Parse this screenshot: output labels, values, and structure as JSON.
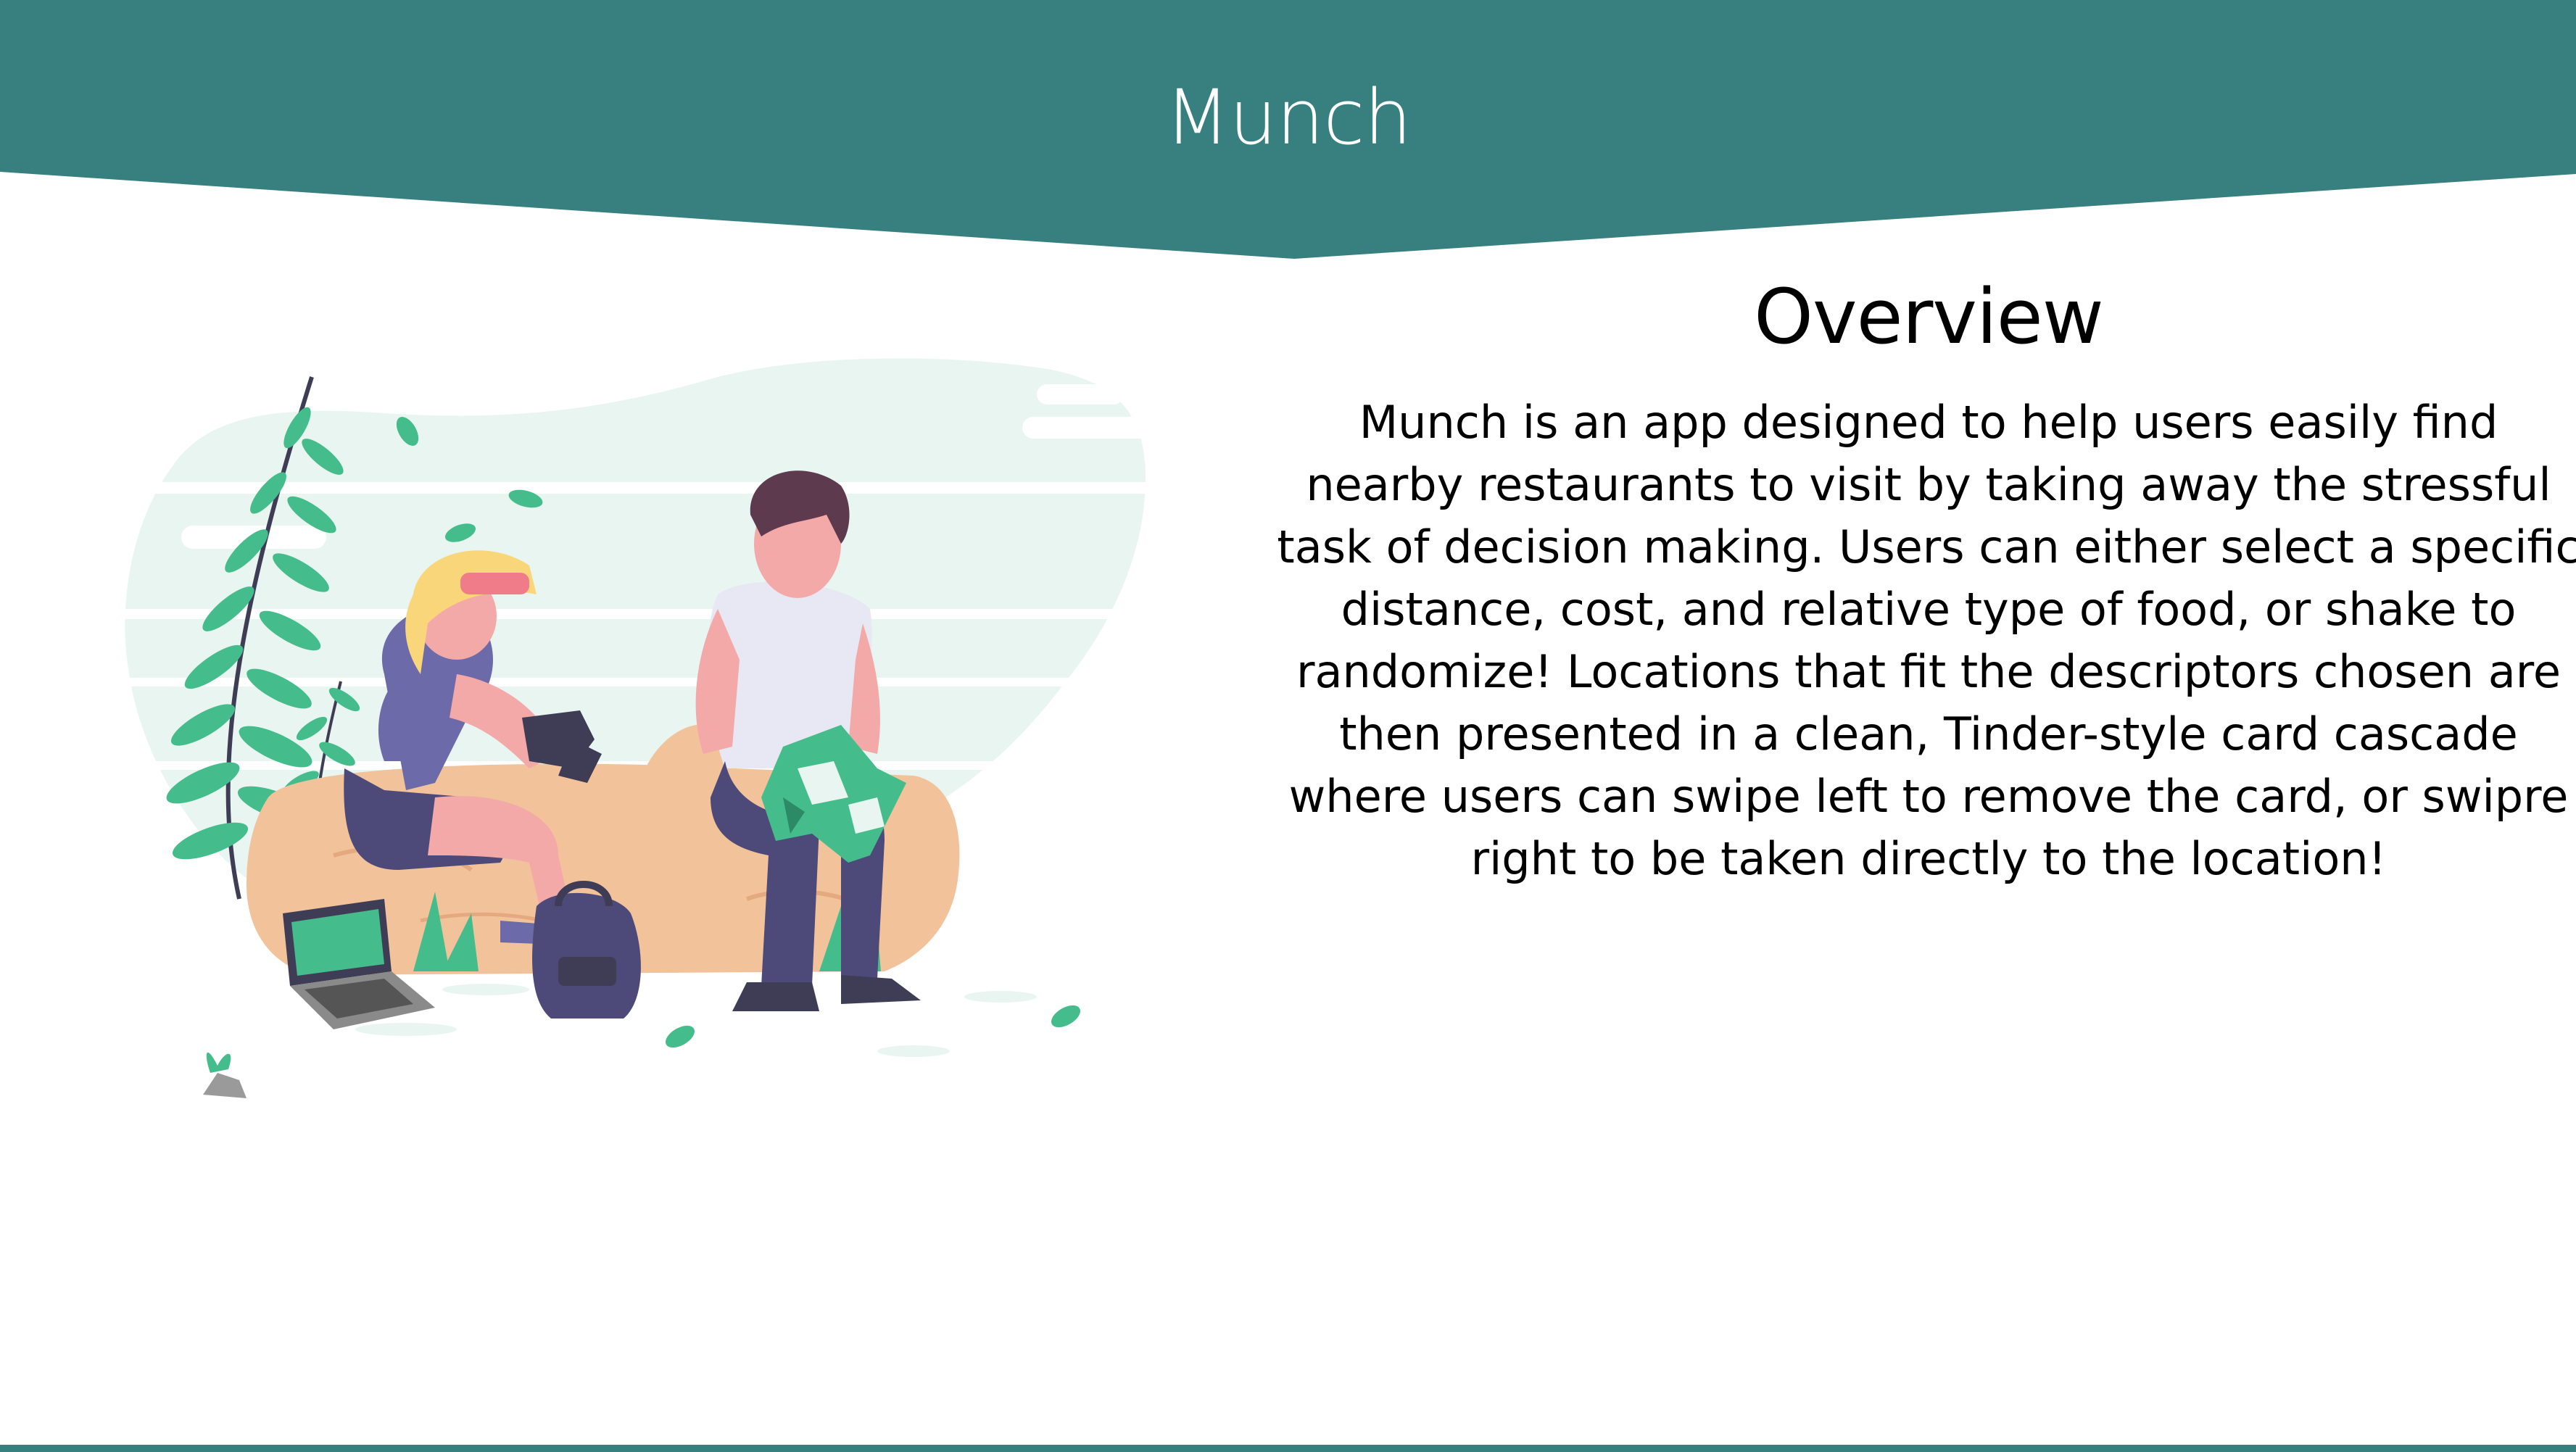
{
  "colors": {
    "brand": "#387f80",
    "accent_green": "#44bc8c",
    "light_mint": "#e8f5f1",
    "wood": "#f2c39b",
    "skin": "#f3a9a7",
    "dark_purple": "#4d4a7a"
  },
  "header": {
    "title": "Munch"
  },
  "overview": {
    "heading": "Overview",
    "body": "Munch is an app designed to help users easily find nearby restaurants to visit by taking away the stressful task of decision making. Users can either select a specific distance, cost, and relative type of food, or shake to randomize! Locations that fit the descriptors chosen are then presented in a clean, Tinder-style card cascade where users can swipe left to remove the card, or swipre right to be taken directly to the location!"
  }
}
